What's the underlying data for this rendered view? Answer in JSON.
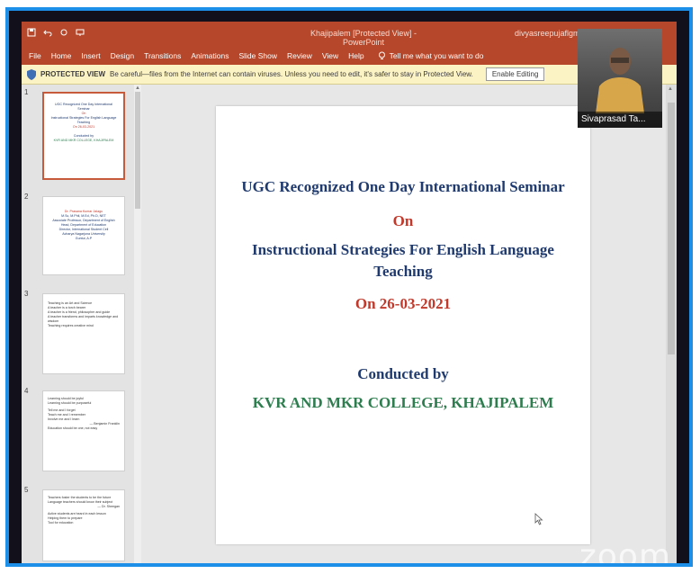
{
  "window": {
    "title": "Khajipalem [Protected View] - PowerPoint",
    "user": "divyasreepujaflgm",
    "accent": "#b7472a"
  },
  "menu": [
    "File",
    "Home",
    "Insert",
    "Design",
    "Transitions",
    "Animations",
    "Slide Show",
    "Review",
    "View",
    "Help"
  ],
  "tell_me": "Tell me what you want to do",
  "protected": {
    "label": "PROTECTED VIEW",
    "message": "Be careful—files from the Internet can contain viruses. Unless you need to edit, it's safer to stay in Protected View.",
    "button": "Enable Editing",
    "icon": "shield-icon"
  },
  "thumbnails": [
    {
      "num": "1",
      "lines": [
        "UGC Recognized One Day International Seminar",
        "On",
        "Instructional Strategies For English Language",
        "Teaching",
        "On 26-03-2021",
        "Conducted by",
        "KVR AND MKR COLLEGE, KHAJIPALEM"
      ]
    },
    {
      "num": "2",
      "lines": [
        "Dr. Prasana Kumar Jalagu",
        "M.Sc, M.Phil, M.Ed, Ph.D, NET",
        "Associate Professor, Department of English",
        "Head, Department of Education",
        "Director, International Student Cell",
        "Acharya Nagarjuna University",
        "Guntur, A.P"
      ]
    },
    {
      "num": "3",
      "lines": [
        "Teaching is an Art and Science",
        "A teacher is a torch bearer",
        "A teacher is a friend, philosopher and guide",
        "A teacher transforms and imparts knowledge and wisdom",
        "Teaching requires creative mind"
      ]
    },
    {
      "num": "4",
      "lines": [
        "Learning should be joyful",
        "Learning should be purposeful",
        "Tell me and I forget",
        "Teach me and I remember",
        "Involve me and I learn",
        "— Benjamin Franklin",
        "Education should be one, not easy"
      ]
    },
    {
      "num": "5",
      "lines": [
        "Teachers foster the students to be the future",
        "Language teachers should know their subject",
        "— Dr. Sheegan",
        "Active students are heard in each lesson",
        "Helping them to prepare",
        "Tool for education"
      ]
    }
  ],
  "slide": {
    "line1": "UGC Recognized One Day International Seminar",
    "line2": "On",
    "line3": "Instructional Strategies For English Language",
    "line4": "Teaching",
    "line5": "On 26-03-2021",
    "line6": "Conducted by",
    "line7": "KVR AND MKR COLLEGE, KHAJIPALEM"
  },
  "participant": {
    "name": "Sivaprasad Ta..."
  },
  "watermark": "zoom"
}
